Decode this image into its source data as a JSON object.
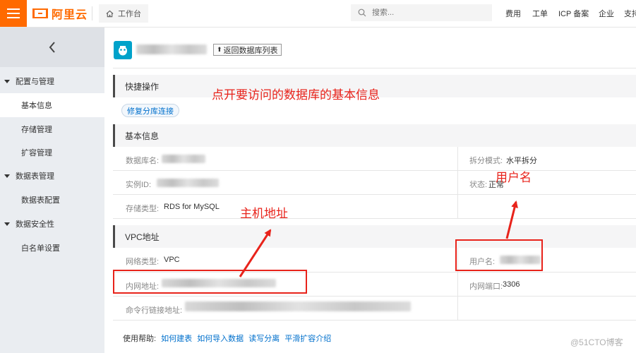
{
  "header": {
    "logo_text": "阿里云",
    "workbench_label": "工作台",
    "search_placeholder": "搜索...",
    "nav": [
      "费用",
      "工单",
      "ICP 备案",
      "企业",
      "支持"
    ]
  },
  "sidebar": {
    "groups": [
      {
        "label": "配置与管理",
        "items": [
          "基本信息",
          "存储管理",
          "扩容管理"
        ]
      },
      {
        "label": "数据表管理",
        "items": [
          "数据表配置"
        ]
      },
      {
        "label": "数据安全性",
        "items": [
          "白名单设置"
        ]
      }
    ],
    "active_item": "基本信息"
  },
  "page": {
    "back_button": "返回数据库列表"
  },
  "quick_ops": {
    "title": "快捷操作",
    "repair_button": "修复分库连接"
  },
  "basic_info": {
    "title": "基本信息",
    "db_name_label": "数据库名:",
    "instance_id_label": "实例ID:",
    "storage_type_label": "存储类型:",
    "storage_type_value": "RDS for MySQL",
    "split_mode_label": "拆分模式:",
    "split_mode_value": "水平拆分",
    "status_label": "状态:",
    "status_value": "正常"
  },
  "vpc": {
    "title": "VPC地址",
    "network_type_label": "网络类型:",
    "network_type_value": "VPC",
    "intranet_addr_label": "内网地址:",
    "cmd_conn_label": "命令行链接地址:",
    "username_label": "用户名:",
    "intranet_port_label": "内网端口:",
    "intranet_port_value": "3306"
  },
  "help": {
    "label": "使用帮助:",
    "links": [
      "如何建表",
      "如何导入数据",
      "读写分离",
      "平滑扩容介绍"
    ]
  },
  "annotations": {
    "click_db": "点开要访问的数据库的基本信息",
    "username": "用户名",
    "host": "主机地址"
  },
  "watermark": "@51CTO博客",
  "colors": {
    "brand": "#ff6a00",
    "link": "#0070cc",
    "annotation": "#e8231b",
    "db_icon": "#00a2ca"
  }
}
